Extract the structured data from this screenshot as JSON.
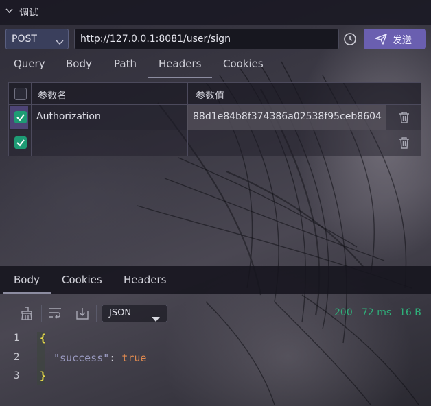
{
  "panel": {
    "title": "调试"
  },
  "request": {
    "method": "POST",
    "url": "http://127.0.0.1:8081/user/sign",
    "send_label": "发送",
    "tabs": [
      "Query",
      "Body",
      "Path",
      "Headers",
      "Cookies"
    ],
    "active_tab": "Headers"
  },
  "headers_table": {
    "columns": [
      "参数名",
      "参数值"
    ],
    "rows": [
      {
        "checked": true,
        "name": "Authorization",
        "value": "88d1e84b8f374386a02538f95ceb8604"
      },
      {
        "checked": true,
        "name": "",
        "value": ""
      }
    ]
  },
  "response": {
    "tabs": [
      "Body",
      "Cookies",
      "Headers"
    ],
    "active_tab": "Body",
    "format": "JSON",
    "status": "200",
    "time": "72 ms",
    "size": "16 B",
    "code": {
      "line_numbers": [
        "1",
        "2",
        "3"
      ],
      "open": "{",
      "key": "\"success\"",
      "colon": ": ",
      "value": "true",
      "close": "}"
    }
  },
  "colors": {
    "accent": "#6a5fb0",
    "success": "#2fb07a",
    "checkbox": "#1e9b74"
  }
}
